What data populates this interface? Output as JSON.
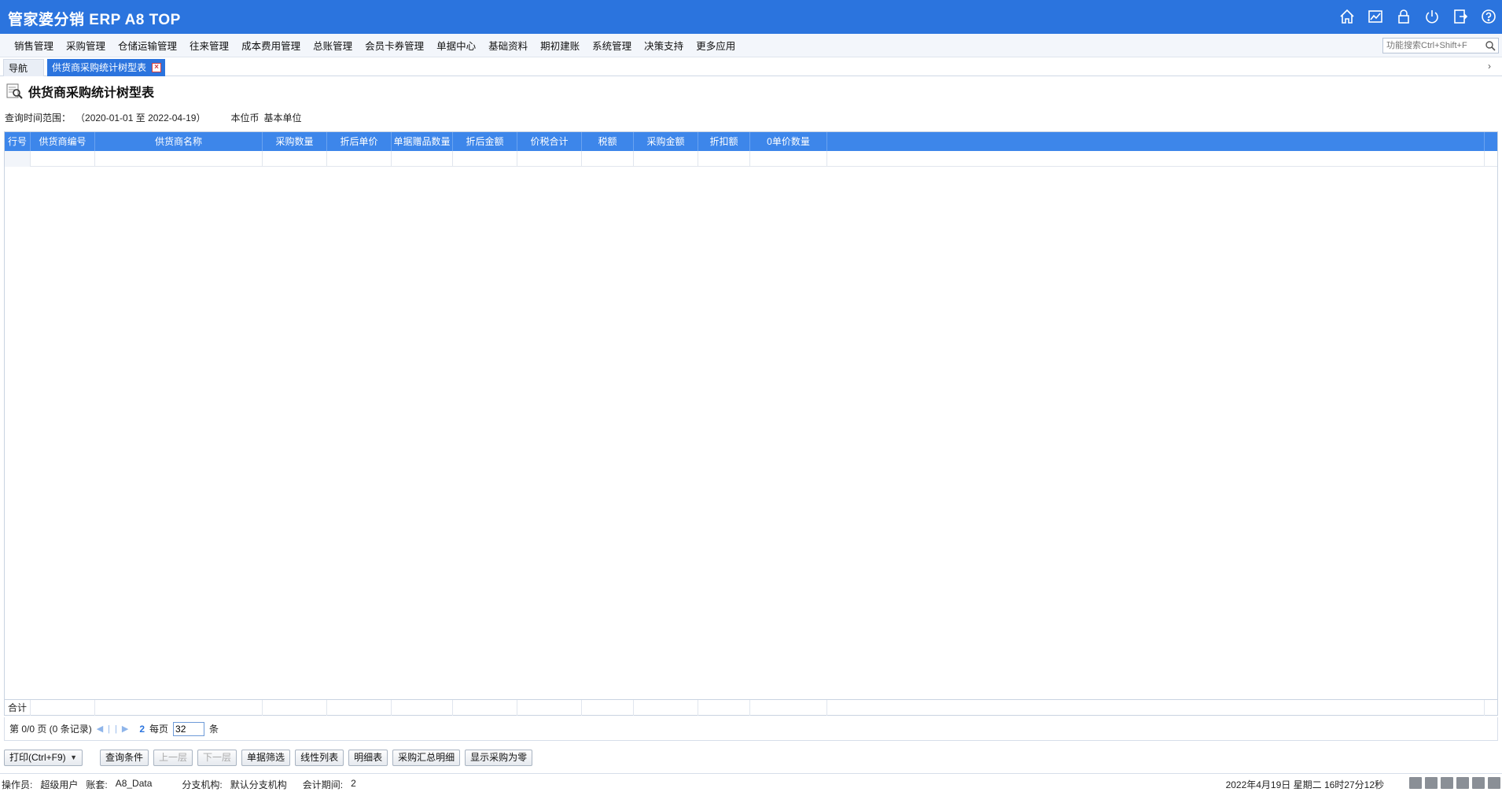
{
  "app": {
    "title": "管家婆分销 ERP A8 TOP"
  },
  "menu": {
    "items": [
      "销售管理",
      "采购管理",
      "仓储运输管理",
      "往来管理",
      "成本费用管理",
      "总账管理",
      "会员卡券管理",
      "单据中心",
      "基础资料",
      "期初建账",
      "系统管理",
      "决策支持",
      "更多应用"
    ],
    "search_placeholder": "功能搜索Ctrl+Shift+F"
  },
  "tabs": {
    "nav": "导航",
    "active": "供货商采购统计树型表"
  },
  "report": {
    "title": "供货商采购统计树型表",
    "range_label": "查询时间范围：",
    "range_value": "（2020-01-01 至  2022-04-19）",
    "currency_label": "本位币",
    "unit_label": "基本单位"
  },
  "grid": {
    "columns": [
      "行号",
      "供货商编号",
      "供货商名称",
      "采购数量",
      "折后单价",
      "单据赠品数量",
      "折后金额",
      "价税合计",
      "税额",
      "采购金额",
      "折扣额",
      "0单价数量",
      ""
    ],
    "total_label": "合计"
  },
  "pager": {
    "page_text": "第  0/0 页  (0 条记录)",
    "nav_first": "◀",
    "nav_prev": "|",
    "nav_next": "|",
    "nav_last": "▶",
    "refresh": "2",
    "per_page_label": "每页",
    "per_page_value": "32",
    "per_page_unit": "条"
  },
  "toolbar": {
    "print": "打印(Ctrl+F9)",
    "query": "查询条件",
    "up": "上一层",
    "down": "下一层",
    "filter": "单据筛选",
    "linear": "线性列表",
    "detail": "明细表",
    "summary_detail": "采购汇总明细",
    "show_zero": "显示采购为零"
  },
  "status": {
    "operator_label": "操作员:",
    "operator": "超级用户",
    "account_label": "账套:",
    "account": "A8_Data",
    "branch_label": "分支机构:",
    "branch": "默认分支机构",
    "period_label": "会计期间:",
    "period": "2",
    "datetime": "2022年4月19日  星期二  16时27分12秒"
  },
  "colors": {
    "titlebar": "#2b74de",
    "grid_header": "#3d86ea"
  }
}
